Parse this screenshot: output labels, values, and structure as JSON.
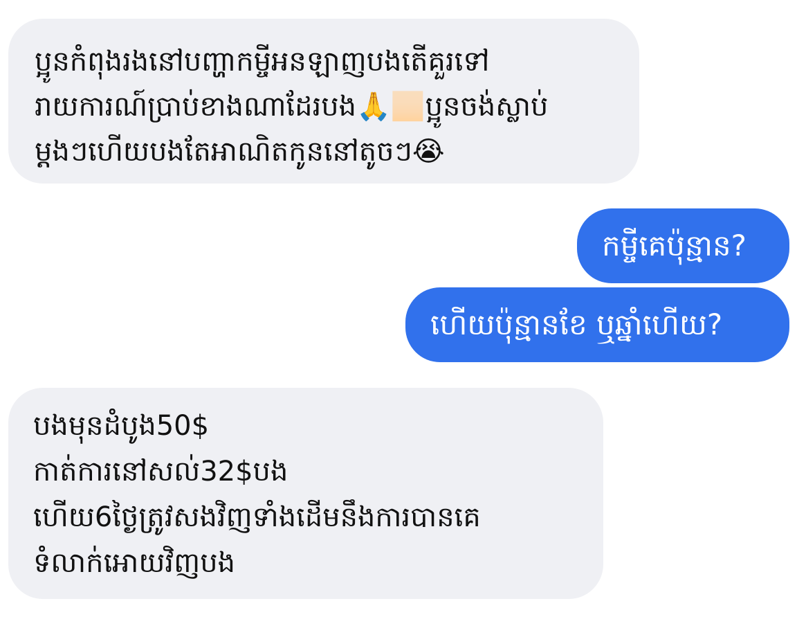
{
  "messages": [
    {
      "direction": "incoming",
      "lines": [
        "ប្អូនកំពុងរងនៅបញ្ហាកម្ចីអនឡាញបងតើគួរទៅ",
        "រាយការណ៍ប្រាប់ខាងណាដែរបង🙏🏻ប្អូនចង់ស្លាប់",
        "ម្តងៗហើយបងតែអាណិតកូននៅតូចៗ😭"
      ]
    },
    {
      "direction": "outgoing",
      "lines": [
        "កម្ចីគេប៉ុន្មាន?"
      ]
    },
    {
      "direction": "outgoing",
      "lines": [
        "ហើយប៉ុន្មានខែ ឬឆ្នាំហើយ?"
      ]
    },
    {
      "direction": "incoming",
      "lines": [
        "បងមុនដំបូង50$",
        "កាត់ការនៅសល់32$បង",
        "ហើយ6ថ្ងៃត្រូវសងវិញទាំងដើមនឹងការបានគេ",
        "ទំលាក់អោយវិញបង"
      ]
    }
  ],
  "colors": {
    "incoming_bubble": "#eff0f4",
    "outgoing_bubble": "#3171ec",
    "incoming_text": "#111111",
    "outgoing_text": "#ffffff"
  }
}
